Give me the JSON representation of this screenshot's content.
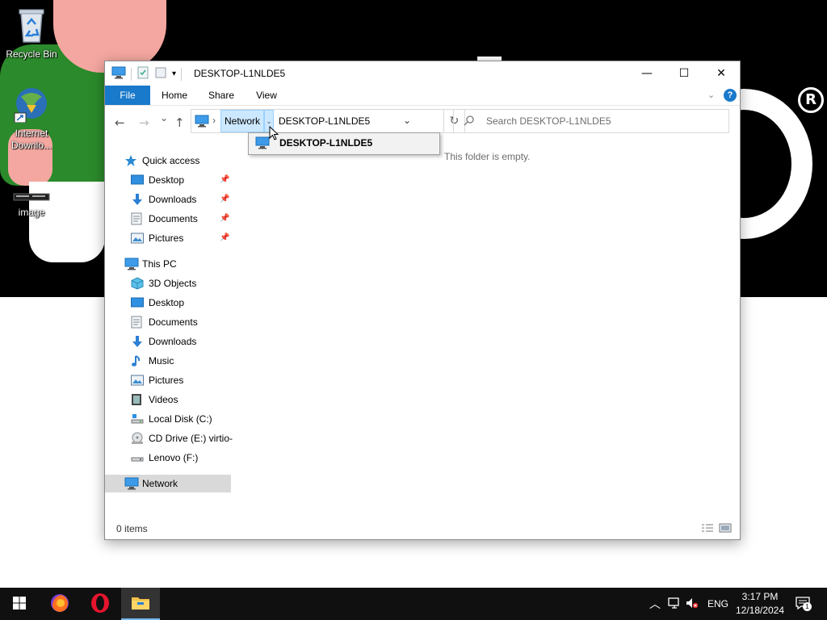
{
  "desktop": {
    "icons": [
      {
        "label": "Recycle Bin",
        "icon": "recycle-bin-icon"
      },
      {
        "label": "Internet Downlo...",
        "icon": "internet-download-manager-icon"
      },
      {
        "label": "image",
        "icon": "image-file-icon"
      }
    ]
  },
  "window": {
    "title": "DESKTOP-L1NLDE5",
    "minimize": "—",
    "maximize": "☐",
    "close": "✕"
  },
  "ribbon": {
    "tabs": [
      "File",
      "Home",
      "Share",
      "View"
    ]
  },
  "navigation": {
    "back": "←",
    "forward": "→",
    "recent": "⌄",
    "up": "↑",
    "refresh": "↻"
  },
  "address": {
    "crumbs": [
      "Network",
      "DESKTOP-L1NLDE5"
    ],
    "popup_item": "DESKTOP-L1NLDE5"
  },
  "search": {
    "placeholder": "Search DESKTOP-L1NLDE5"
  },
  "sidebar": {
    "quick_access": "Quick access",
    "quick_items": [
      "Desktop",
      "Downloads",
      "Documents",
      "Pictures"
    ],
    "this_pc": "This PC",
    "pc_items": [
      "3D Objects",
      "Desktop",
      "Documents",
      "Downloads",
      "Music",
      "Pictures",
      "Videos",
      "Local Disk (C:)",
      "CD Drive (E:) virtio-",
      "Lenovo (F:)"
    ],
    "network": "Network"
  },
  "content": {
    "empty_message": "This folder is empty."
  },
  "status": {
    "items": "0 items"
  },
  "taskbar": {
    "apps": [
      "start-icon",
      "firefox-icon",
      "opera-icon",
      "file-explorer-icon"
    ],
    "language": "ENG",
    "time": "3:17 PM",
    "date": "12/18/2024",
    "notifications": "1"
  },
  "colors": {
    "accent": "#1979ca",
    "selection": "#cce8ff",
    "taskbar": "#101010"
  }
}
